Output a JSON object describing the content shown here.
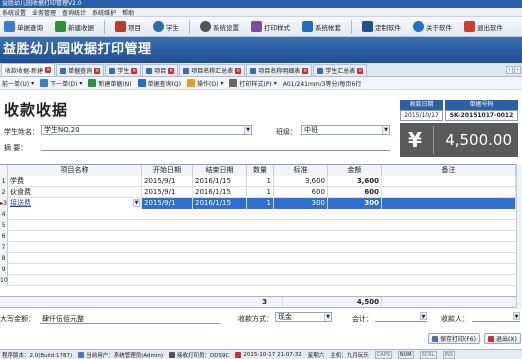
{
  "window": {
    "title": "益胜幼儿园收据打印管理V2.0"
  },
  "menu": [
    "系统设置",
    "业务管理",
    "查询统计",
    "系统维护",
    "帮助"
  ],
  "toolbar": [
    {
      "label": "单据查询",
      "icon": "search-doc-icon",
      "color": "#3a7bd5"
    },
    {
      "label": "新建收据",
      "icon": "new-doc-icon",
      "color": "#2f8f3a"
    },
    {
      "label": "项目",
      "icon": "grid-icon",
      "color": "#c0392b"
    },
    {
      "label": "学生",
      "icon": "student-icon",
      "color": "#2b6cb0"
    },
    {
      "label": "系统设置",
      "icon": "gear-icon",
      "color": "#555555"
    },
    {
      "label": "打印样式",
      "icon": "print-style-icon",
      "color": "#7b4fa0"
    },
    {
      "label": "系统帐套",
      "icon": "account-icon",
      "color": "#1e6fbf"
    },
    {
      "label": "定制软件",
      "icon": "custom-icon",
      "color": "#1f4f93"
    },
    {
      "label": "关于软件",
      "icon": "info-icon",
      "color": "#1f6ed4"
    },
    {
      "label": "退出软件",
      "icon": "exit-icon",
      "color": "#d23b2f"
    }
  ],
  "banner": {
    "title": "益胜幼儿园收据打印管理"
  },
  "tabs": [
    {
      "label": "收款收据-新建",
      "active": true
    },
    {
      "label": "单据查询"
    },
    {
      "label": "学生"
    },
    {
      "label": "项目"
    },
    {
      "label": "项目名称汇总表"
    },
    {
      "label": "项目名称明细表"
    },
    {
      "label": "学生汇总表"
    }
  ],
  "subbar": {
    "prev": "前一单(U)",
    "next": "下一单(D)",
    "new": "新建单据(N)",
    "query": "单据查询(Q)",
    "operate": "操作(O)",
    "print_style": "打印样式(P)",
    "paper": "A01/241mm/3等分/每页6行"
  },
  "form": {
    "title": "收款收据",
    "student_label": "学生姓名：",
    "student_value": "学生NO.20",
    "class_label": "班级：",
    "class_value": "中班",
    "summary_label": "摘    要：",
    "summary_value": "",
    "date_label": "收款日期",
    "date_value": "2015/10/17",
    "docno_label": "单据号码",
    "docno_value": "SK-20151017-0012",
    "currency_symbol": "¥",
    "amount": "4,500.00"
  },
  "grid": {
    "columns": [
      "项目名称",
      "开始日期",
      "结束日期",
      "数量",
      "标准",
      "金额",
      "备注"
    ],
    "rows": [
      {
        "n": "1",
        "name": "学费",
        "start": "2015/9/1",
        "end": "2016/1/15",
        "qty": "1",
        "std": "3,600",
        "amt": "3,600",
        "note": ""
      },
      {
        "n": "2",
        "name": "伙食费",
        "start": "2015/9/1",
        "end": "2016/1/15",
        "qty": "1",
        "std": "600",
        "amt": "600",
        "note": ""
      },
      {
        "n": "3",
        "name": "接送费",
        "start": "2015/9/1",
        "end": "2016/1/15",
        "qty": "1",
        "std": "300",
        "amt": "300",
        "note": ""
      }
    ],
    "empty_rows": [
      "4",
      "5",
      "6",
      "7",
      "8",
      "9",
      "10"
    ],
    "total_qty": "3",
    "total_amt": "4,500"
  },
  "footer": {
    "capital_label": "大写金额：",
    "capital_value": "肆仟伍佰元整",
    "pay_method_label": "收款方式：",
    "pay_method_value": "现金",
    "accountant_label": "会计：",
    "payee_label": "收款人：",
    "save_print_btn": "保存打印(F6)",
    "exit_btn": "退出(X)"
  },
  "status": {
    "version": "程序版本：2.0(Build:1787)",
    "user": "当前用户：系统管理员(Admin)",
    "printer": "接收打印员：DDS9C",
    "datetime": "2015-10-17 21:07:32",
    "weekday": "星期六",
    "user_short": "主机：九月玩乐",
    "keys": [
      "CAPS",
      "NUM",
      "SCRL",
      "INS"
    ]
  }
}
